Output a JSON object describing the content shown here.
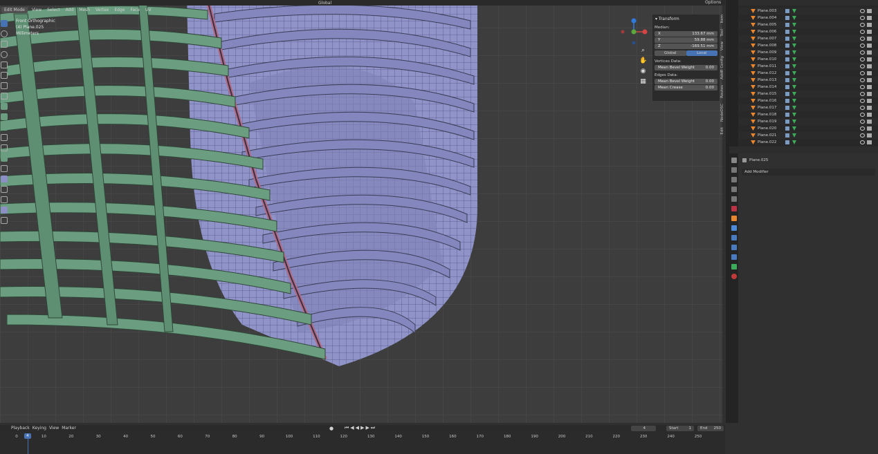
{
  "header": {
    "mode": "Edit Mode",
    "menus": [
      "View",
      "Select",
      "Add",
      "Mesh",
      "Vertex",
      "Edge",
      "Face",
      "UV"
    ],
    "orientation": "Global",
    "options": "Options"
  },
  "viewport": {
    "view_name": "Front Orthographic",
    "object_info": "(4) Plane.025",
    "units": "Millimeters"
  },
  "npanel": {
    "section": "Transform",
    "median_label": "Median:",
    "x_label": "X",
    "x_value": "133.67 mm",
    "y_label": "Y",
    "y_value": "59.88 mm",
    "z_label": "Z",
    "z_value": "-169.51 mm",
    "global": "Global",
    "local": "Local",
    "vertices_label": "Vertices Data:",
    "vert_bevel_label": "Mean Bevel Weight",
    "vert_bevel_value": "0.00",
    "edges_label": "Edges Data:",
    "edge_bevel_label": "Mean Bevel Weight",
    "edge_bevel_value": "0.00",
    "crease_label": "Mean Crease",
    "crease_value": "0.00"
  },
  "sidetabs": [
    "Item",
    "Tool",
    "View",
    "AddR Config",
    "Routes",
    "NodeOSC",
    "Edit"
  ],
  "outliner": {
    "items": [
      "Plane.003",
      "Plane.004",
      "Plane.005",
      "Plane.006",
      "Plane.007",
      "Plane.008",
      "Plane.009",
      "Plane.010",
      "Plane.011",
      "Plane.012",
      "Plane.013",
      "Plane.014",
      "Plane.015",
      "Plane.016",
      "Plane.017",
      "Plane.018",
      "Plane.019",
      "Plane.020",
      "Plane.021",
      "Plane.022"
    ]
  },
  "properties": {
    "object_name": "Plane.025",
    "add_modifier": "Add Modifier"
  },
  "timeline": {
    "menus": [
      "Playback",
      "Keying",
      "View",
      "Marker"
    ],
    "current_frame": "4",
    "start_label": "Start",
    "start_value": "1",
    "end_label": "End",
    "end_value": "250",
    "ticks": [
      "0",
      "10",
      "20",
      "30",
      "40",
      "50",
      "60",
      "70",
      "80",
      "90",
      "100",
      "110",
      "120",
      "130",
      "140",
      "150",
      "160",
      "170",
      "180",
      "190",
      "200",
      "210",
      "220",
      "230",
      "240",
      "250"
    ]
  },
  "colors": {
    "accent": "#4772b3",
    "mesh_green": "#6b9e80",
    "mesh_purple": "#8b8fc4",
    "orange": "#e8862e"
  }
}
